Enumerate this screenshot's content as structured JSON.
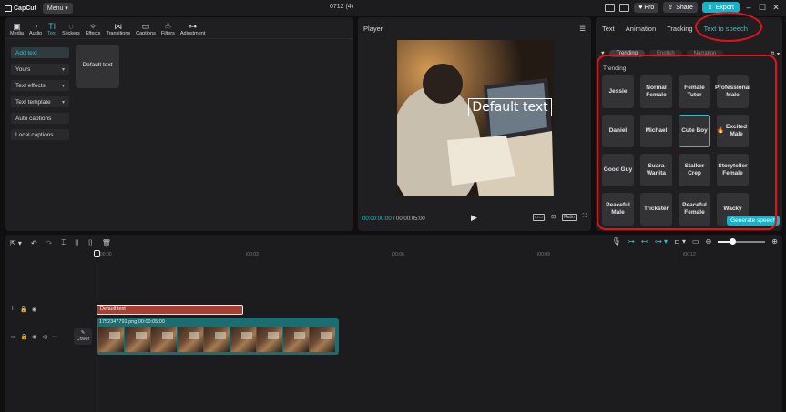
{
  "titlebar": {
    "app_name": "CapCut",
    "menu_label": "Menu",
    "project_title": "0712 (4)",
    "pro_label": "Pro",
    "share_label": "Share",
    "export_label": "Export"
  },
  "toolbar": {
    "tools": [
      {
        "label": "Media",
        "icon": "media-icon",
        "glyph": "▣"
      },
      {
        "label": "Audio",
        "icon": "audio-icon",
        "glyph": "◔"
      },
      {
        "label": "Text",
        "icon": "text-icon",
        "glyph": "TI"
      },
      {
        "label": "Stickers",
        "icon": "sticker-icon",
        "glyph": "◌"
      },
      {
        "label": "Effects",
        "icon": "effects-icon",
        "glyph": "✧"
      },
      {
        "label": "Transitions",
        "icon": "transitions-icon",
        "glyph": "⋈"
      },
      {
        "label": "Captions",
        "icon": "captions-icon",
        "glyph": "▭"
      },
      {
        "label": "Filters",
        "icon": "filters-icon",
        "glyph": "♧"
      },
      {
        "label": "Adjustment",
        "icon": "adjustment-icon",
        "glyph": "⊶"
      }
    ],
    "active_tool": "Text"
  },
  "text_panel": {
    "categories": [
      {
        "label": "Add text",
        "active": true,
        "has_chevron": false
      },
      {
        "label": "Yours",
        "active": false,
        "has_chevron": true
      },
      {
        "label": "Text effects",
        "active": false,
        "has_chevron": true
      },
      {
        "label": "Text template",
        "active": false,
        "has_chevron": true
      },
      {
        "label": "Auto captions",
        "active": false,
        "has_chevron": false
      },
      {
        "label": "Local captions",
        "active": false,
        "has_chevron": false
      }
    ],
    "default_card": "Default text"
  },
  "player": {
    "title": "Player",
    "overlay_text": "Default text",
    "current_time": "00:00:00:00",
    "duration": "00:00:05:00",
    "ratio_label": "Ratio"
  },
  "right_panel": {
    "tabs": [
      "Text",
      "Animation",
      "Tracking",
      "Text to speech"
    ],
    "active_tab": "Text to speech",
    "subtabs": [
      "Trending",
      "English",
      "Narration"
    ],
    "active_subtab": "Trending",
    "section_label": "Trending",
    "voices": [
      {
        "name": "Jessie"
      },
      {
        "name": "Normal Female"
      },
      {
        "name": "Female Tutor"
      },
      {
        "name": "Professional Male"
      },
      {
        "name": "Daniel"
      },
      {
        "name": "Michael"
      },
      {
        "name": "Cute Boy",
        "selected": true
      },
      {
        "name": "Excited Male",
        "flame": true
      },
      {
        "name": "Good Guy"
      },
      {
        "name": "Suara Wanita"
      },
      {
        "name": "Stalker Crep"
      },
      {
        "name": "Storyteller Female"
      },
      {
        "name": "Peaceful Male"
      },
      {
        "name": "Trickster"
      },
      {
        "name": "Peaceful Female"
      },
      {
        "name": "Wacky"
      }
    ],
    "generate_label": "Generate speech"
  },
  "timeline": {
    "ruler_marks": [
      "00:00",
      "|00:03",
      "|00:06",
      "|00:09",
      "|00:12"
    ],
    "text_clip_label": "Default text",
    "video_clip_label": "1752347791.png  00:00:05:00",
    "cover_label": "Cover",
    "frame_count": 9,
    "zoom_level": 0.3
  },
  "colors": {
    "accent": "#29c2d6",
    "annotation": "#e3121a",
    "text_clip": "#a63f33",
    "video_clip": "#1a6e72"
  }
}
